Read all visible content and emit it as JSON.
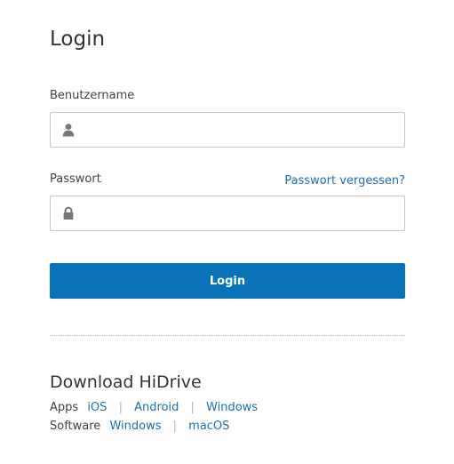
{
  "login": {
    "title": "Login",
    "username_label": "Benutzername",
    "username_value": "",
    "password_label": "Passwort",
    "password_value": "",
    "forgot_password_link": "Passwort vergessen?",
    "submit_label": "Login"
  },
  "download": {
    "title": "Download HiDrive",
    "apps": {
      "label": "Apps",
      "links": [
        "iOS",
        "Android",
        "Windows"
      ]
    },
    "software": {
      "label": "Software",
      "links": [
        "Windows",
        "macOS"
      ]
    },
    "separator": "|"
  },
  "icons": {
    "username": "user-icon",
    "password": "lock-icon"
  },
  "colors": {
    "accent": "#0a73b8",
    "link": "#1f70b5",
    "text": "#333333",
    "border": "#c8c8c8"
  }
}
